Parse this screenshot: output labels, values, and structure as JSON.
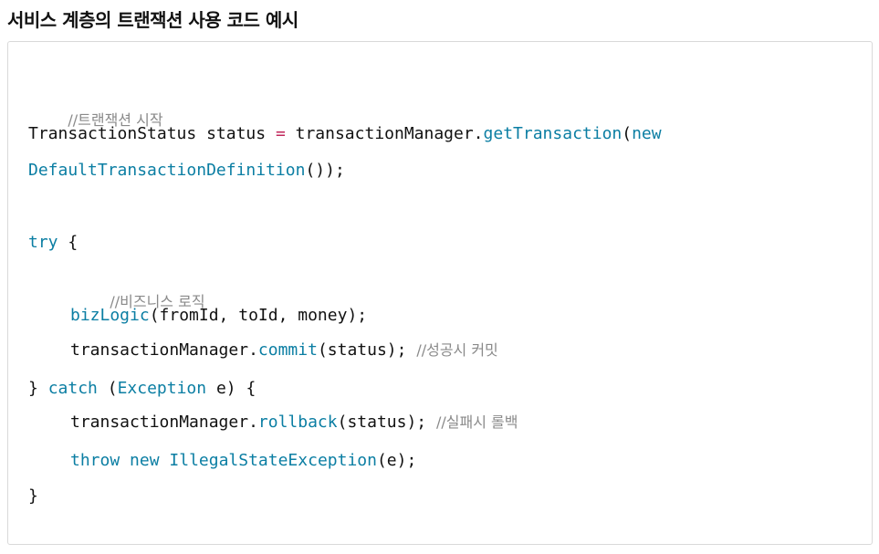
{
  "page": {
    "title": "서비스 계층의 트랜잭션 사용 코드 예시"
  },
  "code": {
    "line1_comment": "//트랜잭션 시작",
    "line2_prefix": "TransactionStatus status ",
    "line2_eq": "=",
    "line2_mid": " transactionManager.",
    "line2_method": "getTransaction",
    "line2_paren": "(",
    "line2_new": "new",
    "line3_class": "DefaultTransactionDefinition",
    "line3_end": "());",
    "line4_try": "try",
    "line4_brace": " {",
    "line5_comment": "//비즈니스 로직",
    "line6_method": "bizLogic",
    "line6_args": "(fromId, toId, money);",
    "line7_prefix": "transactionManager.",
    "line7_method": "commit",
    "line7_args": "(status); ",
    "line7_comment": "//성공시 커밋",
    "line8_close": "} ",
    "line8_catch": "catch",
    "line8_paren": " (",
    "line8_type": "Exception",
    "line8_rest": " e) {",
    "line9_prefix": "transactionManager.",
    "line9_method": "rollback",
    "line9_args": "(status); ",
    "line9_comment": "//실패시 롤백",
    "line10_throw": "throw",
    "line10_space": " ",
    "line10_new": "new",
    "line10_space2": " ",
    "line10_type": "IllegalStateException",
    "line10_args": "(e);",
    "line11_close": "}"
  },
  "colors": {
    "keyword": "#0b7ea3",
    "comment": "#8a8a8a",
    "operator": "#c1275b",
    "text": "#111111",
    "border": "#d9d9d9"
  }
}
